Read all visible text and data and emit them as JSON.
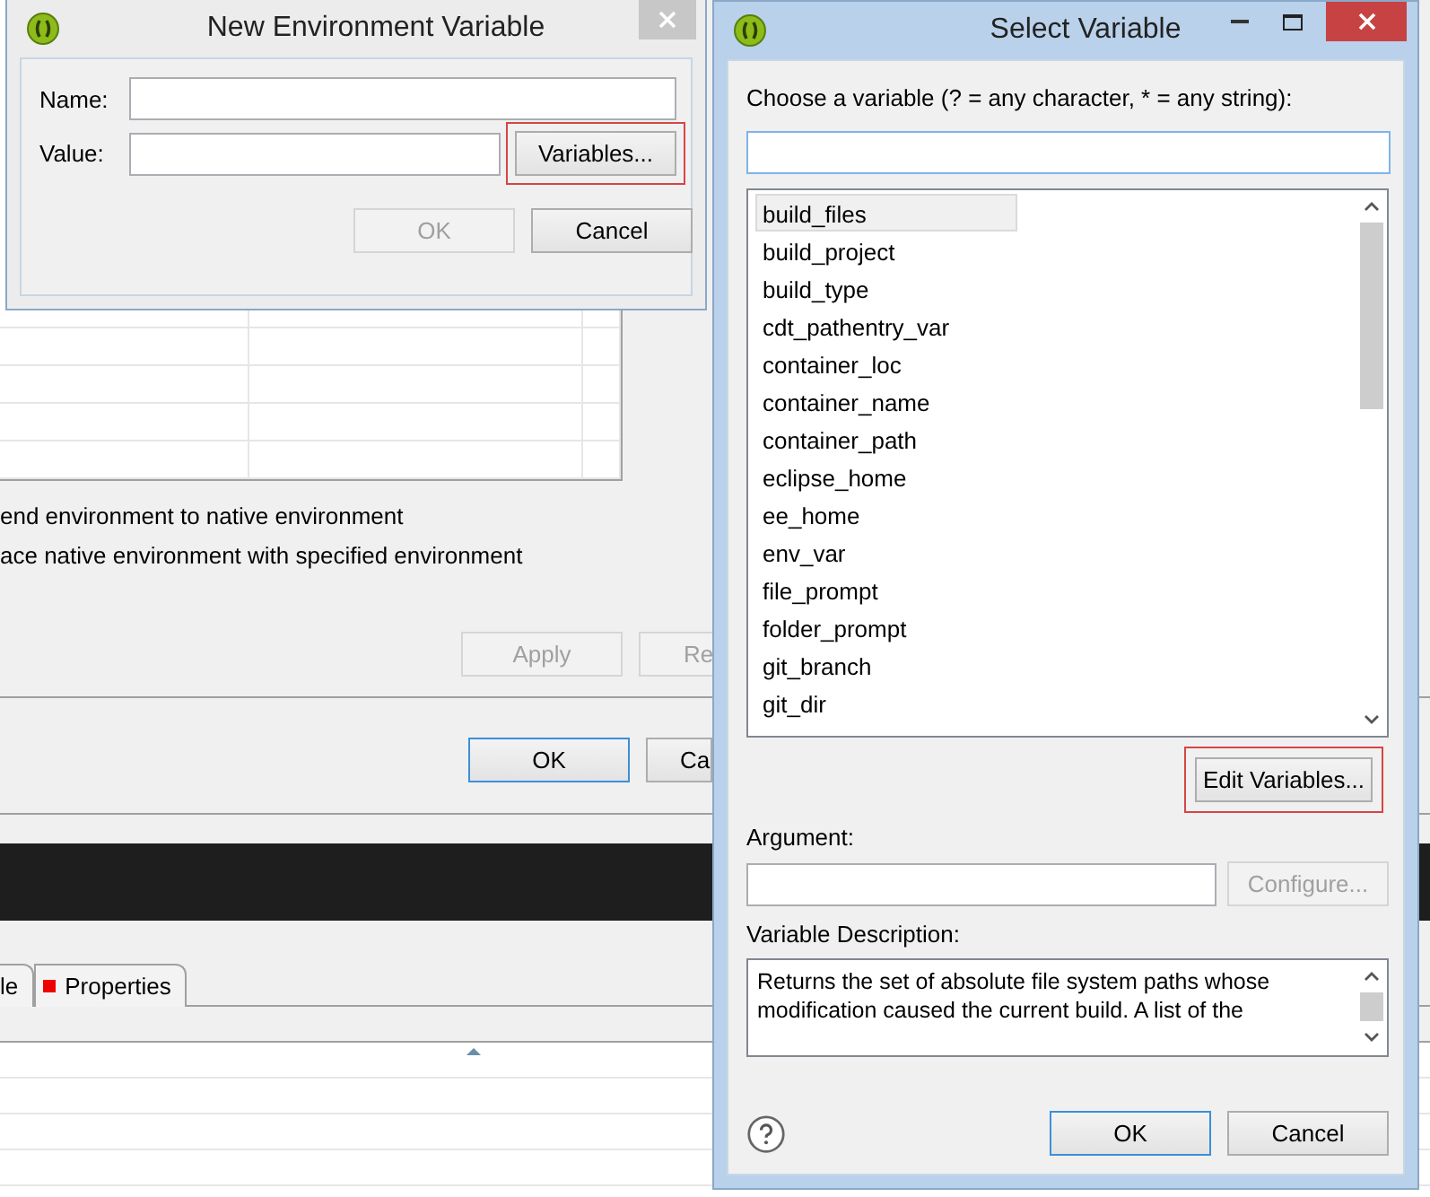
{
  "background": {
    "env_options": [
      {
        "label": "end environment to native environment"
      },
      {
        "label": "ace native environment with specified environment"
      }
    ],
    "apply_button": {
      "label": "Apply",
      "disabled": true
    },
    "restore_button": {
      "label": "Re",
      "disabled": true
    },
    "ok_button": {
      "label": "OK",
      "disabled": false
    },
    "cancel_button": {
      "label": "Ca",
      "disabled": false
    },
    "tabs": [
      {
        "label": "le"
      },
      {
        "label": "Properties"
      }
    ]
  },
  "new_variable_dialog": {
    "title": "New Environment Variable",
    "fields": [
      {
        "label": "Name:"
      },
      {
        "label": "Value:"
      }
    ],
    "variables_button": {
      "label": "Variables...",
      "disabled": false
    },
    "ok_button": {
      "label": "OK",
      "disabled": true
    },
    "cancel_button": {
      "label": "Cancel",
      "disabled": false
    }
  },
  "select_variable_dialog": {
    "title": "Select Variable",
    "prompt": "Choose a variable (? = any character, * = any string):",
    "variables": [
      {
        "name": "build_files",
        "selected": true
      },
      {
        "name": "build_project",
        "selected": false
      },
      {
        "name": "build_type",
        "selected": false
      },
      {
        "name": "cdt_pathentry_var",
        "selected": false
      },
      {
        "name": "container_loc",
        "selected": false
      },
      {
        "name": "container_name",
        "selected": false
      },
      {
        "name": "container_path",
        "selected": false
      },
      {
        "name": "eclipse_home",
        "selected": false
      },
      {
        "name": "ee_home",
        "selected": false
      },
      {
        "name": "env_var",
        "selected": false
      },
      {
        "name": "file_prompt",
        "selected": false
      },
      {
        "name": "folder_prompt",
        "selected": false
      },
      {
        "name": "git_branch",
        "selected": false
      },
      {
        "name": "git_dir",
        "selected": false
      }
    ],
    "edit_variables_button": {
      "label": "Edit Variables...",
      "disabled": false
    },
    "argument_label": "Argument:",
    "configure_button": {
      "label": "Configure...",
      "disabled": true
    },
    "description_label": "Variable Description:",
    "description": "Returns the set of absolute file system paths whose modification caused the current build.  A list of the",
    "ok_button": {
      "label": "OK",
      "disabled": false
    },
    "cancel_button": {
      "label": "Cancel",
      "disabled": false
    }
  }
}
